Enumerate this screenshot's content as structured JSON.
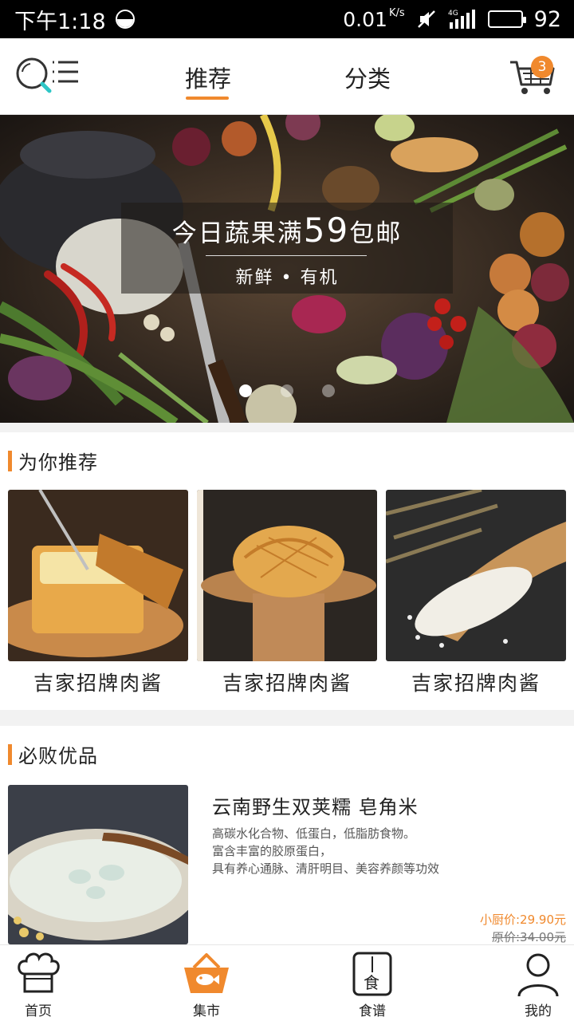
{
  "status_bar": {
    "time": "下午1:18",
    "speed": "0.01",
    "speed_unit": "K/s",
    "network": "4G",
    "battery": "92"
  },
  "header": {
    "tabs": [
      {
        "label": "推荐",
        "active": true
      },
      {
        "label": "分类",
        "active": false
      }
    ],
    "cart_count": "3",
    "accent_color": "#f0892d"
  },
  "banner": {
    "title_prefix": "今日蔬果满",
    "title_number": "59",
    "title_suffix": "包邮",
    "subtitle": "新鲜 • 有机",
    "slide_count": 3,
    "active_slide": 1
  },
  "recommend": {
    "title": "为你推荐",
    "items": [
      {
        "name": "吉家招牌肉酱"
      },
      {
        "name": "吉家招牌肉酱"
      },
      {
        "name": "吉家招牌肉酱"
      }
    ]
  },
  "featured": {
    "title": "必败优品",
    "product": {
      "name": "云南野生双荚糯 皂角米",
      "desc": [
        "高碳水化合物、低蛋白，低脂肪食物。",
        "富含丰富的胶原蛋白，",
        "具有养心通脉、清肝明目、美容养颜等功效"
      ],
      "price_now": "小厨价:29.90元",
      "price_orig": "原价:34.00元"
    }
  },
  "bottom_nav": [
    {
      "label": "首页",
      "icon": "chef-hat-icon"
    },
    {
      "label": "集市",
      "icon": "basket-icon",
      "active": true
    },
    {
      "label": "食谱",
      "icon": "recipe-book-icon"
    },
    {
      "label": "我的",
      "icon": "user-icon"
    }
  ]
}
